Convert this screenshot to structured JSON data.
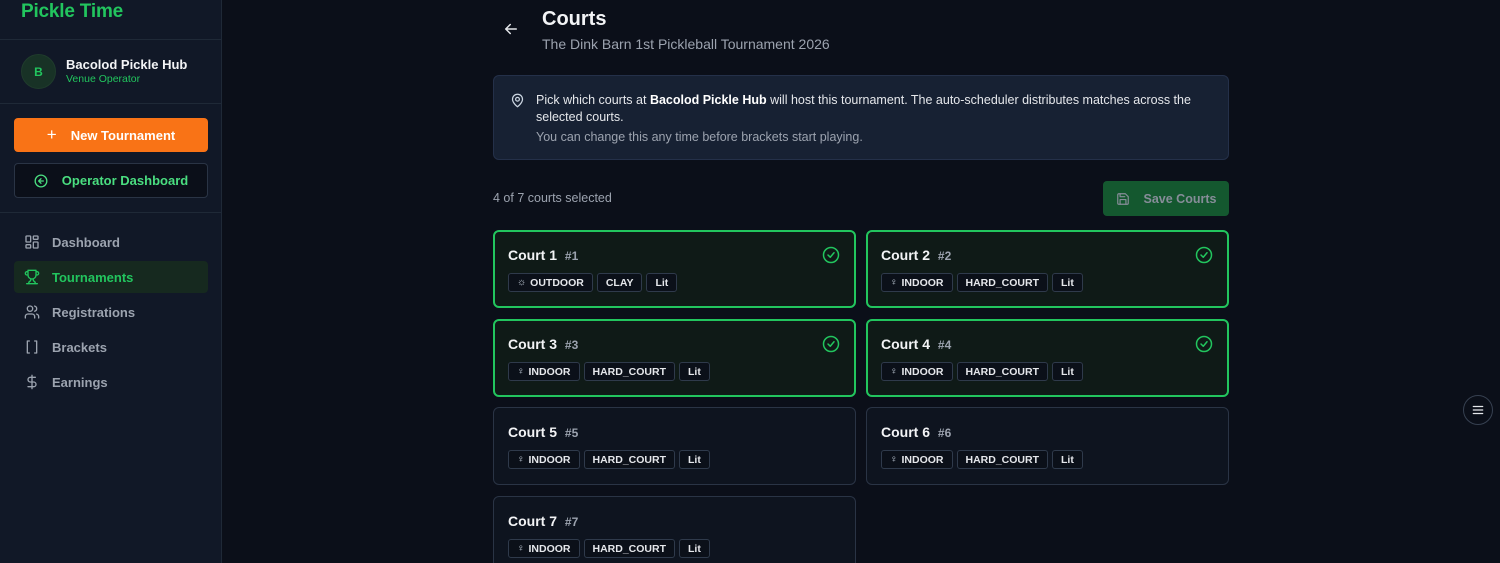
{
  "brand": "Pickle Time",
  "venue": {
    "initial": "B",
    "name": "Bacolod Pickle Hub",
    "role": "Venue Operator"
  },
  "actions": {
    "new_tournament": "New Tournament",
    "operator_dashboard": "Operator Dashboard"
  },
  "nav": [
    {
      "label": "Dashboard",
      "icon": "dashboard-icon",
      "active": false
    },
    {
      "label": "Tournaments",
      "icon": "trophy-icon",
      "active": true
    },
    {
      "label": "Registrations",
      "icon": "users-icon",
      "active": false
    },
    {
      "label": "Brackets",
      "icon": "brackets-icon",
      "active": false
    },
    {
      "label": "Earnings",
      "icon": "dollar-icon",
      "active": false
    }
  ],
  "page": {
    "title": "Courts",
    "subtitle": "The Dink Barn 1st Pickleball Tournament 2026"
  },
  "info": {
    "pre": "Pick which courts at ",
    "venue": "Bacolod Pickle Hub",
    "post": " will host this tournament. The auto-scheduler distributes matches across the selected courts.",
    "note": "You can change this any time before brackets start playing."
  },
  "selection": {
    "count_text": "4 of 7 courts selected",
    "save_label": "Save Courts"
  },
  "courts": [
    {
      "name": "Court 1",
      "num": "#1",
      "selected": true,
      "tags": [
        {
          "label": "OUTDOOR",
          "icon": "sun-icon"
        },
        {
          "label": "CLAY"
        },
        {
          "label": "Lit"
        }
      ]
    },
    {
      "name": "Court 2",
      "num": "#2",
      "selected": true,
      "tags": [
        {
          "label": "INDOOR",
          "icon": "bulb-icon"
        },
        {
          "label": "HARD_COURT"
        },
        {
          "label": "Lit"
        }
      ]
    },
    {
      "name": "Court 3",
      "num": "#3",
      "selected": true,
      "tags": [
        {
          "label": "INDOOR",
          "icon": "bulb-icon"
        },
        {
          "label": "HARD_COURT"
        },
        {
          "label": "Lit"
        }
      ]
    },
    {
      "name": "Court 4",
      "num": "#4",
      "selected": true,
      "tags": [
        {
          "label": "INDOOR",
          "icon": "bulb-icon"
        },
        {
          "label": "HARD_COURT"
        },
        {
          "label": "Lit"
        }
      ]
    },
    {
      "name": "Court 5",
      "num": "#5",
      "selected": false,
      "tags": [
        {
          "label": "INDOOR",
          "icon": "bulb-icon"
        },
        {
          "label": "HARD_COURT"
        },
        {
          "label": "Lit"
        }
      ]
    },
    {
      "name": "Court 6",
      "num": "#6",
      "selected": false,
      "tags": [
        {
          "label": "INDOOR",
          "icon": "bulb-icon"
        },
        {
          "label": "HARD_COURT"
        },
        {
          "label": "Lit"
        }
      ]
    },
    {
      "name": "Court 7",
      "num": "#7",
      "selected": false,
      "tags": [
        {
          "label": "INDOOR",
          "icon": "bulb-icon"
        },
        {
          "label": "HARD_COURT"
        },
        {
          "label": "Lit"
        }
      ]
    }
  ],
  "colors": {
    "accent": "#22c55e",
    "primary_button": "#f97316",
    "background": "#0b0f19",
    "sidebar": "#111827"
  }
}
